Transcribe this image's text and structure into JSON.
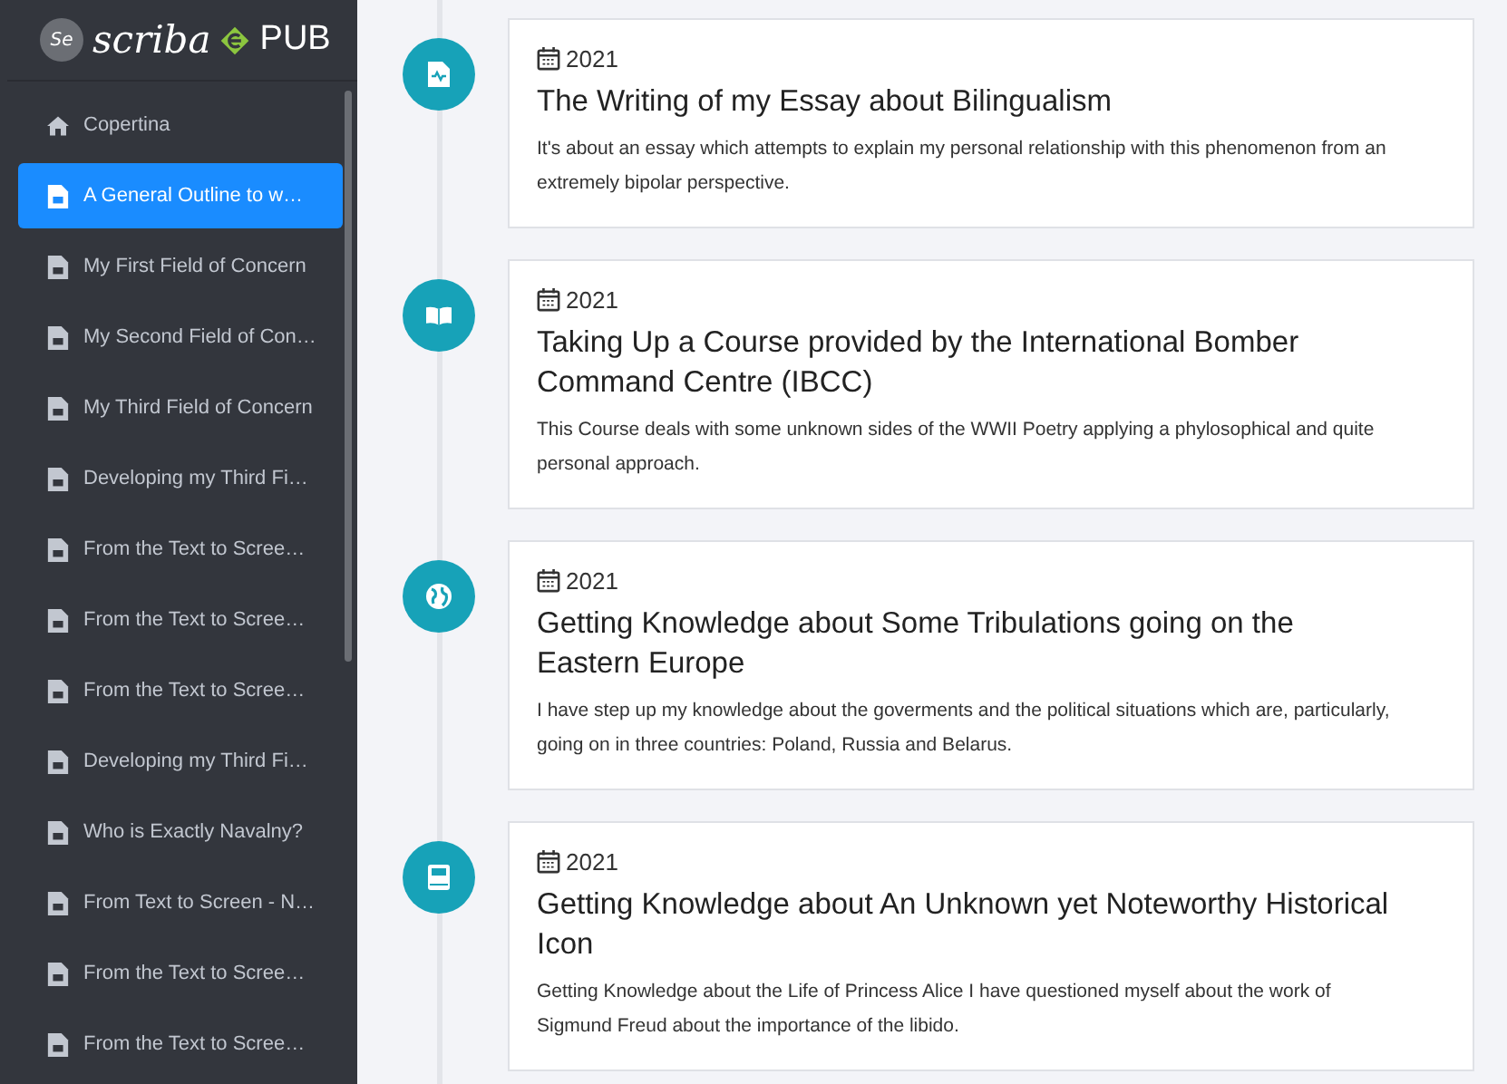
{
  "logo": {
    "badge": "Se",
    "name": "scriba",
    "suffix": "PUB"
  },
  "sidebar": {
    "items": [
      {
        "label": "Copertina",
        "kind": "home",
        "selected": false
      },
      {
        "label": "A General Outline to w…",
        "kind": "page",
        "selected": true
      },
      {
        "label": "My First Field of Concern",
        "kind": "page",
        "selected": false
      },
      {
        "label": "My Second Field of Con…",
        "kind": "page",
        "selected": false
      },
      {
        "label": "My Third Field of Concern",
        "kind": "page",
        "selected": false
      },
      {
        "label": "Developing my Third Fi…",
        "kind": "page",
        "selected": false
      },
      {
        "label": "From the Text to Scree…",
        "kind": "page",
        "selected": false
      },
      {
        "label": "From the Text to Scree…",
        "kind": "page",
        "selected": false
      },
      {
        "label": "From the Text to Scree…",
        "kind": "page",
        "selected": false
      },
      {
        "label": "Developing my Third Fi…",
        "kind": "page",
        "selected": false
      },
      {
        "label": "Who is Exactly Navalny?",
        "kind": "page",
        "selected": false
      },
      {
        "label": "From Text to Screen - N…",
        "kind": "page",
        "selected": false
      },
      {
        "label": "From the Text to Scree…",
        "kind": "page",
        "selected": false
      },
      {
        "label": "From the Text to Scree…",
        "kind": "page",
        "selected": false
      }
    ]
  },
  "timeline": [
    {
      "kind": "essay",
      "date": "2021",
      "title": "The Writing of my Essay about Bilingualism",
      "description": "It's about an essay which attempts to explain my personal relationship with this phenomenon from an extremely bipolar perspective."
    },
    {
      "kind": "course",
      "date": "2021",
      "title": "Taking Up a Course provided by the International Bomber Command Centre (IBCC)",
      "description": "This Course deals with some unknown sides of the WWII Poetry applying a phylosophical and quite personal approach."
    },
    {
      "kind": "world",
      "date": "2021",
      "title": "Getting Knowledge about Some Tribulations going on the Eastern Europe",
      "description": "I have step up my knowledge about the goverments and the political situations which are, particularly, going on in three countries: Poland, Russia and Belarus."
    },
    {
      "kind": "reading",
      "date": "2021",
      "title": "Getting Knowledge about An Unknown yet Noteworthy Historical Icon",
      "description": "Getting Knowledge about the Life of Princess Alice I have questioned myself about the work of Sigmund Freud about the importance of the libido."
    }
  ]
}
